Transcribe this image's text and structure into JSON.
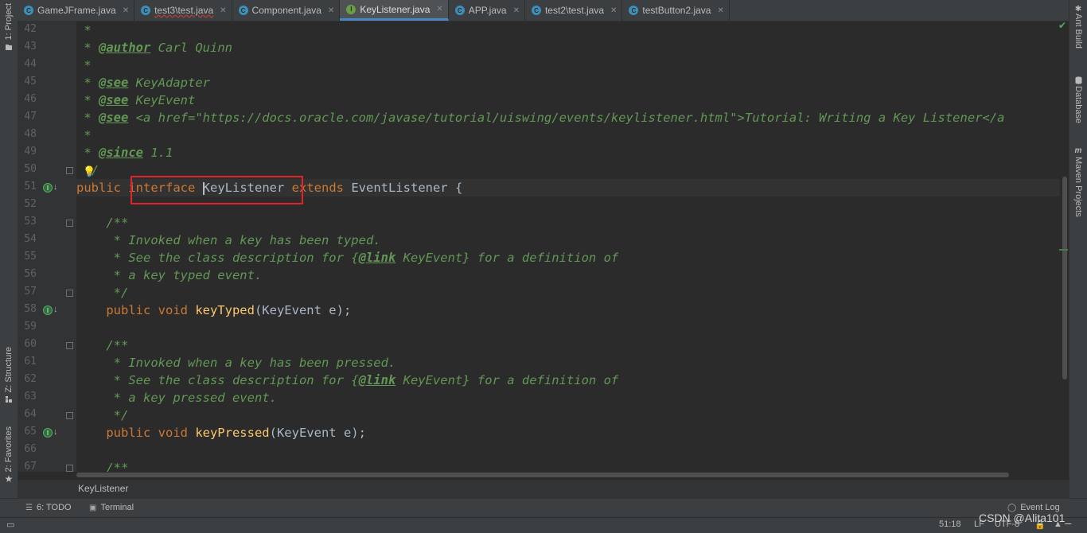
{
  "tabs": [
    {
      "label": "GameJFrame.java",
      "icon": "class",
      "active": false,
      "error": false
    },
    {
      "label": "test3\\test.java",
      "icon": "class",
      "active": false,
      "error": true
    },
    {
      "label": "Component.java",
      "icon": "class",
      "active": false,
      "error": false
    },
    {
      "label": "KeyListener.java",
      "icon": "interface",
      "active": true,
      "error": false
    },
    {
      "label": "APP.java",
      "icon": "class",
      "active": false,
      "error": false
    },
    {
      "label": "test2\\test.java",
      "icon": "class",
      "active": false,
      "error": false
    },
    {
      "label": "testButton2.java",
      "icon": "class",
      "active": false,
      "error": false
    }
  ],
  "left_tools": {
    "project": "1: Project",
    "structure": "Z: Structure",
    "favorites": "2: Favorites"
  },
  "right_tools": {
    "ant": "Ant Build",
    "database": "Database",
    "maven": "Maven Projects"
  },
  "line_numbers": [
    "42",
    "43",
    "44",
    "45",
    "46",
    "47",
    "48",
    "49",
    "50",
    "51",
    "52",
    "53",
    "54",
    "55",
    "56",
    "57",
    "58",
    "59",
    "60",
    "61",
    "62",
    "63",
    "64",
    "65",
    "66",
    "67"
  ],
  "code": {
    "l42_star": " *",
    "l43_star": " * ",
    "l43_tag": "@author",
    "l43_rest": " Carl Quinn",
    "l44_star": " *",
    "l45_star": " * ",
    "l45_tag": "@see",
    "l45_rest": " KeyAdapter",
    "l46_star": " * ",
    "l46_tag": "@see",
    "l46_rest": " KeyEvent",
    "l47_star": " * ",
    "l47_tag": "@see",
    "l47_rest": " <a href=\"https://docs.oracle.com/javase/tutorial/uiswing/events/keylistener.html\">Tutorial: Writing a Key Listener</a",
    "l48_star": " *",
    "l49_star": " * ",
    "l49_tag": "@since",
    "l49_rest": " 1.1",
    "l50": " */",
    "l51_public": "public ",
    "l51_interface": "interface",
    "l51_name": "KeyListener",
    "l51_extends": " extends ",
    "l51_rest": "EventListener {",
    "l53": "    /**",
    "l54": "     * Invoked when a key has been typed.",
    "l55_a": "     * See the class description for {",
    "l55_tag": "@link",
    "l55_b": " KeyEvent} for a definition of",
    "l56": "     * a key typed event.",
    "l57": "     */",
    "l58_kw": "    public void ",
    "l58_fn": "keyTyped",
    "l58_rest": "(KeyEvent e);",
    "l60": "    /**",
    "l61": "     * Invoked when a key has been pressed.",
    "l62_a": "     * See the class description for {",
    "l62_tag": "@link",
    "l62_b": " KeyEvent} for a definition of",
    "l63": "     * a key pressed event.",
    "l64": "     */",
    "l65_kw": "    public void ",
    "l65_fn": "keyPressed",
    "l65_rest": "(KeyEvent e);",
    "l67": "    /**"
  },
  "breadcrumb": "KeyListener",
  "bottom_tools": {
    "todo": "6: TODO",
    "terminal": "Terminal",
    "event_log": "Event Log"
  },
  "status": {
    "position": "51:18",
    "line_sep": "LF",
    "encoding": "UTF-8"
  },
  "watermark": "CSDN @Alita101_",
  "colors": {
    "keyword": "#cc7832",
    "comment": "#629755",
    "method": "#ffc66d",
    "highlight": "#e0242a"
  }
}
